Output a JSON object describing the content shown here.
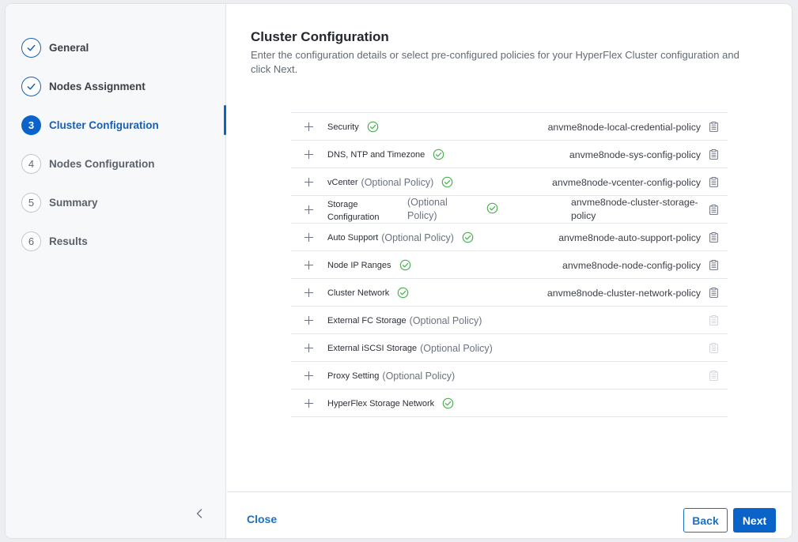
{
  "steps": [
    {
      "num": "1",
      "label": "General",
      "state": "done"
    },
    {
      "num": "2",
      "label": "Nodes Assignment",
      "state": "done"
    },
    {
      "num": "3",
      "label": "Cluster Configuration",
      "state": "current"
    },
    {
      "num": "4",
      "label": "Nodes Configuration",
      "state": "todo"
    },
    {
      "num": "5",
      "label": "Summary",
      "state": "todo"
    },
    {
      "num": "6",
      "label": "Results",
      "state": "todo"
    }
  ],
  "main": {
    "title": "Cluster Configuration",
    "description": "Enter the configuration details or select pre-configured policies for your HyperFlex Cluster configuration and click Next."
  },
  "policies": [
    {
      "name": "Security",
      "optional": "",
      "check": true,
      "policy": "anvme8node-local-credential-policy",
      "doc": "active"
    },
    {
      "name": "DNS, NTP and Timezone",
      "optional": "",
      "check": true,
      "policy": "anvme8node-sys-config-policy",
      "doc": "active"
    },
    {
      "name": "vCenter",
      "optional": "(Optional Policy)",
      "check": true,
      "policy": "anvme8node-vcenter-config-policy",
      "doc": "active"
    },
    {
      "name": "Storage Configuration",
      "name_line1": "Storage",
      "name_line2": "Configuration",
      "optional": "(Optional Policy)",
      "optional_line1": "(Optional",
      "optional_line2": "Policy)",
      "check": true,
      "policy": "anvme8node-cluster-storage-policy",
      "policy_line1": "anvme8node-cluster-storage-",
      "policy_line2": "policy",
      "doc": "active",
      "twoline": true
    },
    {
      "name": "Auto Support",
      "optional": "(Optional Policy)",
      "check": true,
      "policy": "anvme8node-auto-support-policy",
      "doc": "active"
    },
    {
      "name": "Node IP Ranges",
      "optional": "",
      "check": true,
      "policy": "anvme8node-node-config-policy",
      "doc": "active"
    },
    {
      "name": "Cluster Network",
      "optional": "",
      "check": true,
      "policy": "anvme8node-cluster-network-policy",
      "doc": "active"
    },
    {
      "name": "External FC Storage",
      "optional": "(Optional Policy)",
      "check": false,
      "policy": "",
      "doc": "disabled"
    },
    {
      "name": "External iSCSI Storage",
      "optional": "(Optional Policy)",
      "check": false,
      "policy": "",
      "doc": "disabled"
    },
    {
      "name": "Proxy Setting",
      "optional": "(Optional Policy)",
      "check": false,
      "policy": "",
      "doc": "disabled"
    },
    {
      "name": "HyperFlex Storage Network",
      "optional": "",
      "check": true,
      "policy": "",
      "doc": "none"
    }
  ],
  "footer": {
    "close_label": "Close",
    "back_label": "Back",
    "next_label": "Next"
  },
  "colors": {
    "accent": "#0a63c9",
    "link": "#1a6fc7",
    "success": "#4caf50"
  }
}
